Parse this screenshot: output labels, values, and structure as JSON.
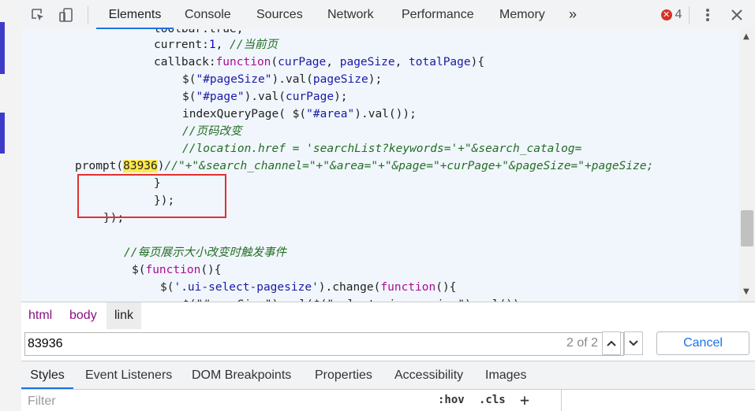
{
  "toolbar": {
    "tabs": [
      "Elements",
      "Console",
      "Sources",
      "Network",
      "Performance",
      "Memory"
    ],
    "more_tabs": "»",
    "error_count": "4",
    "colors": {
      "accent": "#1a73e8",
      "error": "#d93025"
    }
  },
  "code": {
    "lines": [
      {
        "text": "toolbar:true,"
      },
      {
        "parts": [
          [
            "",
            "current:"
          ],
          [
            "num",
            "1"
          ],
          [
            "",
            ", "
          ],
          [
            "cmt",
            "//当前页"
          ]
        ]
      },
      {
        "parts": [
          [
            "",
            "callback:"
          ],
          [
            "kw",
            "function"
          ],
          [
            "",
            "("
          ],
          [
            "var",
            "curPage"
          ],
          [
            "",
            ", "
          ],
          [
            "var",
            "pageSize"
          ],
          [
            "",
            ", "
          ],
          [
            "var",
            "totalPage"
          ],
          [
            "",
            "){"
          ]
        ]
      },
      {
        "parts": [
          [
            "",
            "$("
          ],
          [
            "str",
            "\"#pageSize\""
          ],
          [
            "",
            ").val("
          ],
          [
            "var",
            "pageSize"
          ],
          [
            "",
            ");"
          ]
        ]
      },
      {
        "parts": [
          [
            "",
            "$("
          ],
          [
            "str",
            "\"#page\""
          ],
          [
            "",
            ").val("
          ],
          [
            "var",
            "curPage"
          ],
          [
            "",
            ");"
          ]
        ]
      },
      {
        "parts": [
          [
            "",
            "indexQueryPage( $("
          ],
          [
            "str",
            "\"#area\""
          ],
          [
            "",
            ").val());"
          ]
        ]
      },
      {
        "parts": [
          [
            "cmt",
            "//页码改变"
          ]
        ]
      },
      {
        "parts": [
          [
            "cmt",
            "//location.href = 'searchList?keywords='+\"&search_catalog="
          ]
        ]
      },
      {
        "parts": [
          [
            "",
            "prompt("
          ],
          [
            "hl",
            "83936"
          ],
          [
            "",
            ")"
          ],
          [
            "cmt",
            "//\"+\"&search_channel=\"+\"&area=\"+\"&page=\"+curPage+\"&pageSize=\"+pageSize;"
          ]
        ]
      },
      {
        "parts": [
          [
            "",
            "}"
          ]
        ]
      },
      {
        "parts": [
          [
            "",
            "});"
          ]
        ]
      },
      {
        "parts": [
          [
            "",
            "});"
          ]
        ]
      },
      {
        "parts": [
          [
            "cmt",
            "//每页展示大小改变时触发事件"
          ]
        ]
      },
      {
        "parts": [
          [
            "",
            "$("
          ],
          [
            "kw",
            "function"
          ],
          [
            "",
            "(){"
          ]
        ]
      },
      {
        "parts": [
          [
            "",
            "$("
          ],
          [
            "str",
            "'.ui-select-pagesize'"
          ],
          [
            "",
            ").change("
          ],
          [
            "kw",
            "function"
          ],
          [
            "",
            "(){"
          ]
        ]
      },
      {
        "parts": [
          [
            "",
            "$(\"#pageSize\").val($(\"select.ui-pagesize\").val());"
          ]
        ]
      }
    ]
  },
  "breadcrumb": {
    "items": [
      "html",
      "body",
      "link"
    ]
  },
  "search": {
    "value": "83936",
    "match_count": "2 of 2",
    "cancel_label": "Cancel"
  },
  "styles_tabs": [
    "Styles",
    "Event Listeners",
    "DOM Breakpoints",
    "Properties",
    "Accessibility",
    "Images"
  ],
  "styles_toolbar": {
    "filter_placeholder": "Filter",
    "hov_label": ":hov",
    "cls_label": ".cls",
    "add_label": "+"
  }
}
